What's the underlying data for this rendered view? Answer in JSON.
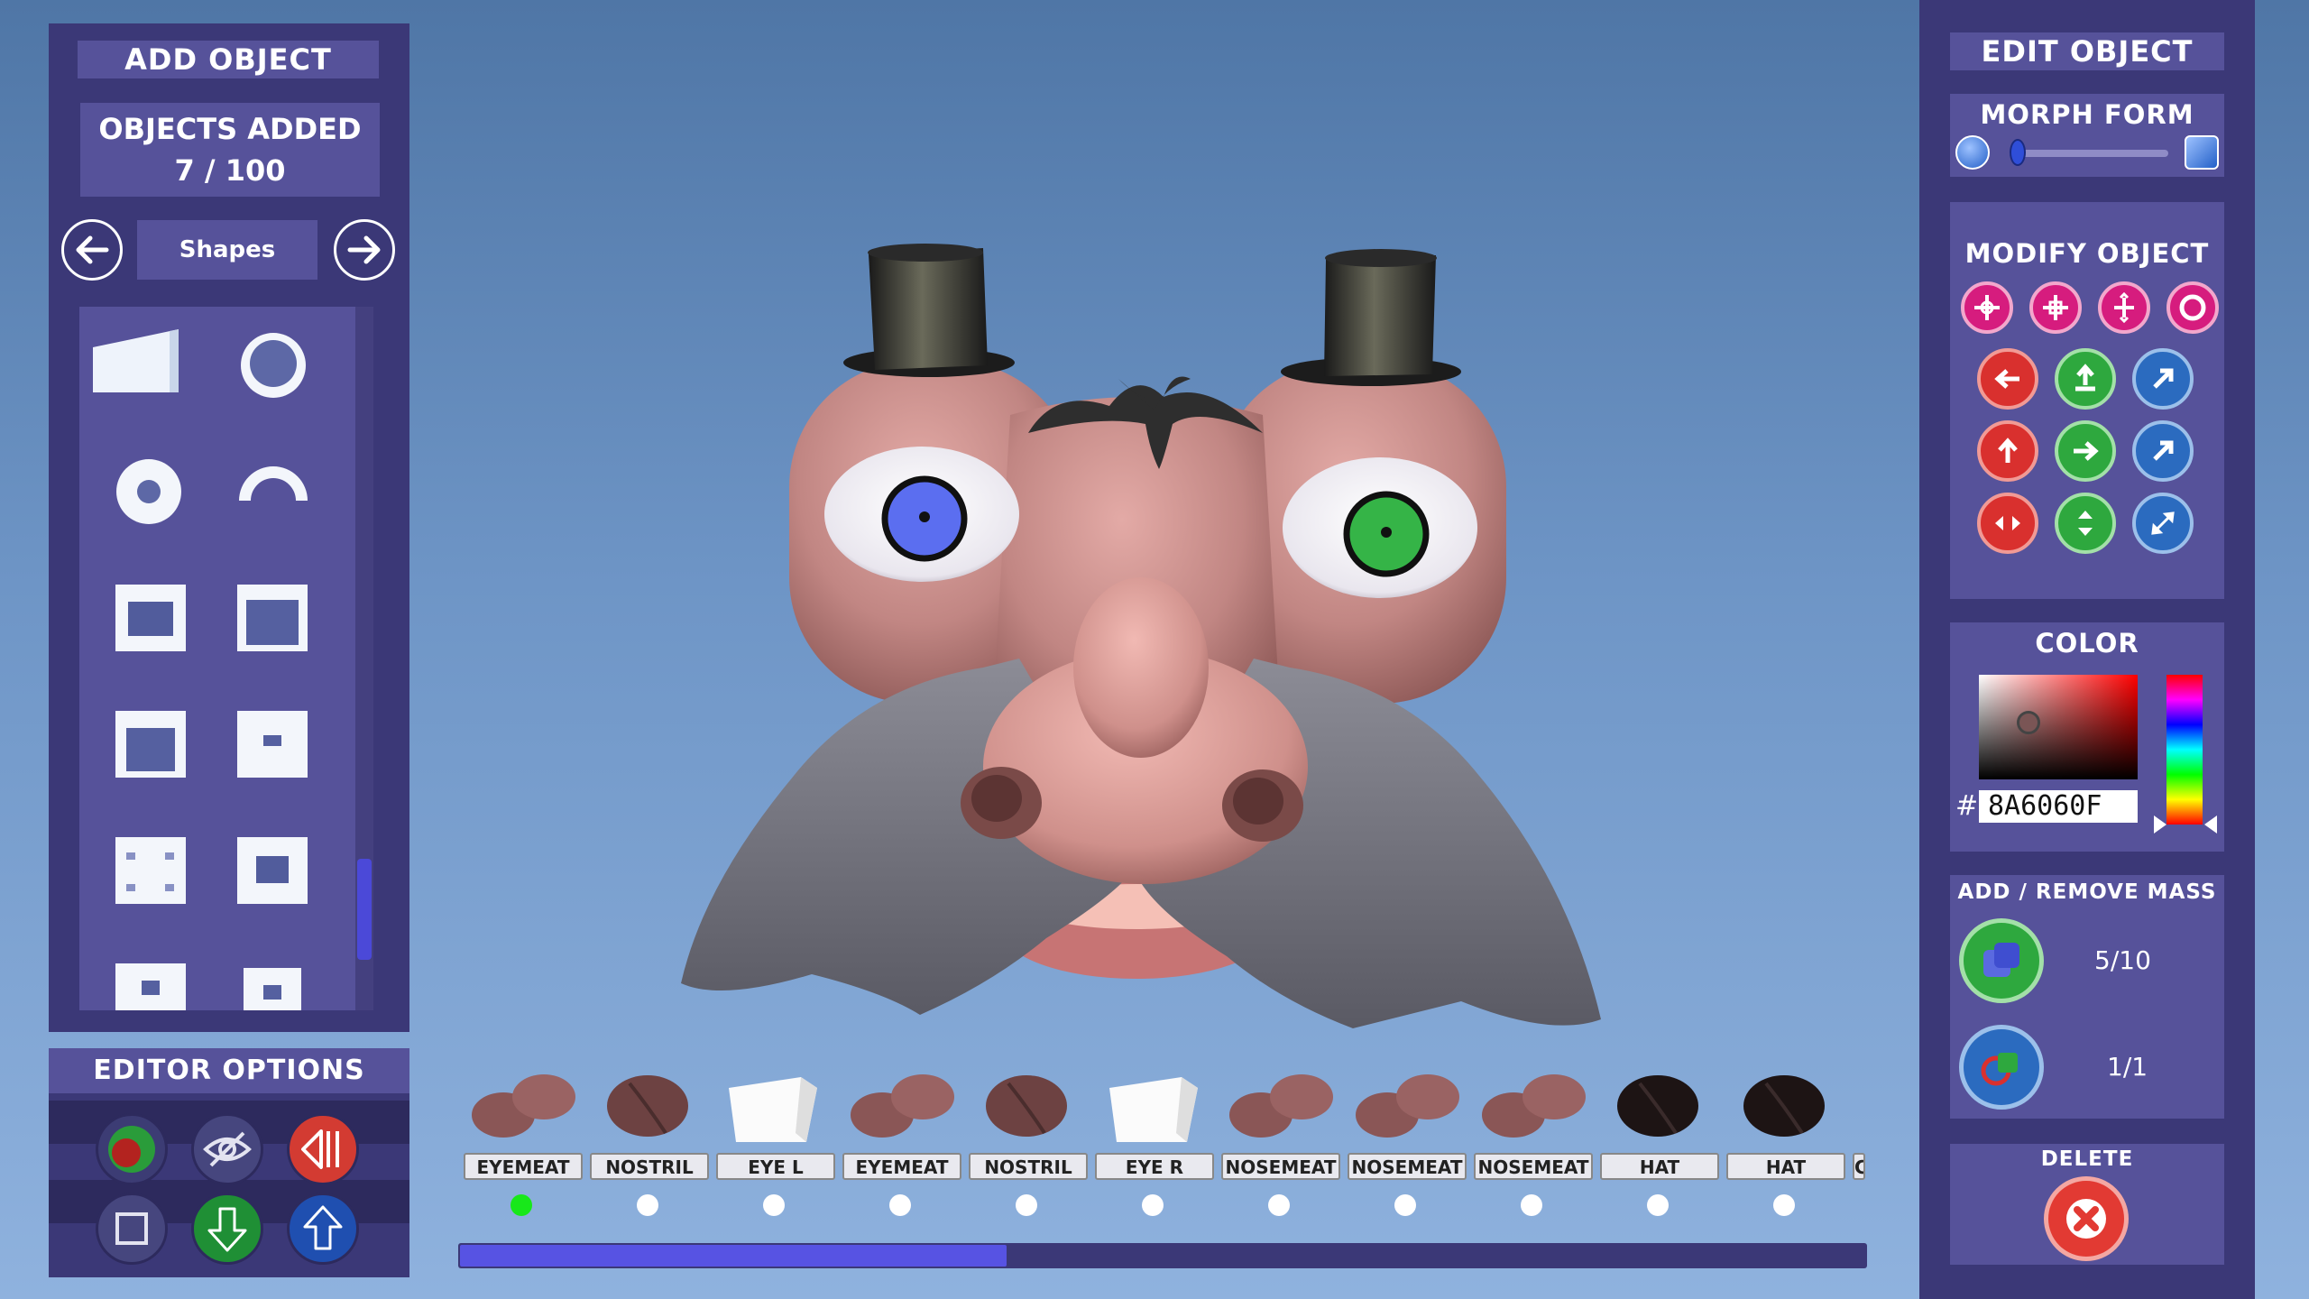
{
  "add_object": {
    "title": "ADD OBJECT",
    "objects_added_label": "OBJECTS ADDED",
    "objects_added_count": "7 / 100",
    "category": "Shapes",
    "scroll_position": 0.72
  },
  "editor_options": {
    "title": "EDITOR OPTIONS"
  },
  "edit_object": {
    "title": "EDIT OBJECT",
    "morph_form": {
      "title": "MORPH FORM",
      "value": 0.05
    },
    "modify_object": {
      "title": "MODIFY OBJECT"
    },
    "color": {
      "title": "COLOR",
      "hash": "#",
      "hex_value": "8A6060F"
    },
    "mass": {
      "title": "ADD / REMOVE MASS",
      "add_count": "5/10",
      "remove_count": "1/1"
    },
    "delete": {
      "title": "DELETE"
    }
  },
  "object_list": {
    "items": [
      {
        "label": "EYEMEAT",
        "selected": true
      },
      {
        "label": "NOSTRIL",
        "selected": false
      },
      {
        "label": "EYE L",
        "selected": false
      },
      {
        "label": "EYEMEAT",
        "selected": false
      },
      {
        "label": "NOSTRIL",
        "selected": false
      },
      {
        "label": "EYE R",
        "selected": false
      },
      {
        "label": "NOSEMEAT",
        "selected": false
      },
      {
        "label": "NOSEMEAT",
        "selected": false
      },
      {
        "label": "NOSEMEAT",
        "selected": false
      },
      {
        "label": "HAT",
        "selected": false
      },
      {
        "label": "HAT",
        "selected": false
      },
      {
        "label": "C",
        "selected": false
      }
    ],
    "scroll_fraction": 0.39
  },
  "colors": {
    "panel": "#3b3877",
    "panel_light": "#56529a",
    "skin": "#c58a8a",
    "mustache": "#777780",
    "selected_dot": "#18e81a"
  }
}
